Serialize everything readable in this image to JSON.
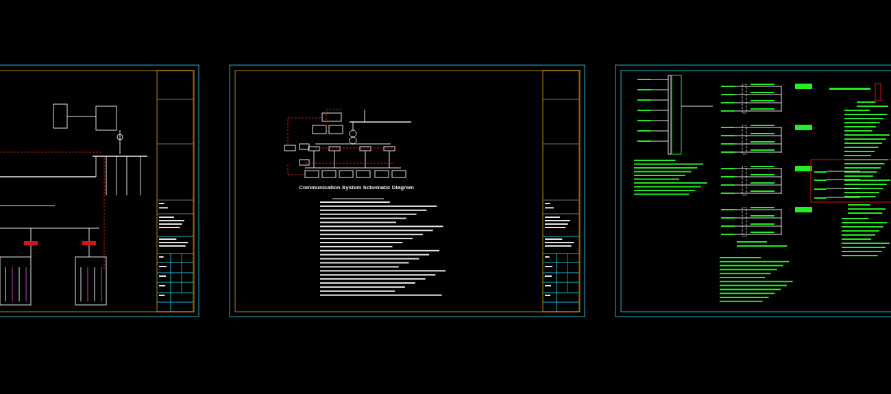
{
  "drawing_area": {
    "sheets": [
      {
        "kind": "single-line"
      },
      {
        "kind": "communication",
        "title": "Communication System Schematic Diagram"
      },
      {
        "kind": "wiring"
      }
    ]
  }
}
